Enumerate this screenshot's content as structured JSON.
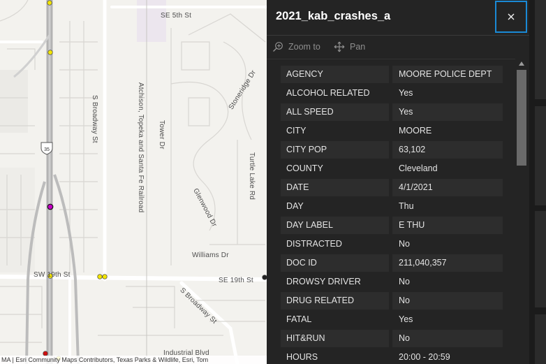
{
  "map": {
    "streets": {
      "se_5th": "SE 5th St",
      "s_broadway": "S Broadway St",
      "railroad": "Atchison, Topeka and Santa Fe Railroad",
      "tower": "Tower Dr",
      "stoneridge": "Stoneridge Dr",
      "turtle_lake": "Turtle Lake Rd",
      "glenwood": "Glenwood Dr",
      "williams": "Williams Dr",
      "sw_19th": "SW 19th St",
      "se_19th": "SE 19th St",
      "s_broadway_ave": "S Broadway St",
      "industrial": "Industrial Blvd"
    },
    "shield_number": "35",
    "attribution": "MA | Esri Community Maps Contributors, Texas Parks & Wildlife, Esri, Tom",
    "colors": {
      "crash_point": "#f2e400",
      "selected_point": "#c400c4",
      "fatal_point": "#cc1010",
      "highway": "#a9a9a9"
    }
  },
  "popup": {
    "title": "2021_kab_crashes_a",
    "close_icon": "close-icon",
    "actions": {
      "zoom_label": "Zoom to",
      "pan_label": "Pan"
    },
    "attributes": [
      {
        "key": "AGENCY",
        "value": "MOORE POLICE DEPT"
      },
      {
        "key": "ALCOHOL RELATED",
        "value": "Yes"
      },
      {
        "key": "ALL SPEED",
        "value": "Yes"
      },
      {
        "key": "CITY",
        "value": "MOORE"
      },
      {
        "key": "CITY POP",
        "value": "63,102"
      },
      {
        "key": "COUNTY",
        "value": "Cleveland"
      },
      {
        "key": "DATE",
        "value": "4/1/2021"
      },
      {
        "key": "DAY",
        "value": "Thu"
      },
      {
        "key": "DAY LABEL",
        "value": "E THU"
      },
      {
        "key": "DISTRACTED",
        "value": "No"
      },
      {
        "key": "DOC ID",
        "value": "211,040,357"
      },
      {
        "key": "DROWSY DRIVER",
        "value": "No"
      },
      {
        "key": "DRUG RELATED",
        "value": "No"
      },
      {
        "key": "FATAL",
        "value": "Yes"
      },
      {
        "key": "HIT&RUN",
        "value": "No"
      },
      {
        "key": "HOURS",
        "value": "20:00 - 20:59"
      }
    ]
  }
}
